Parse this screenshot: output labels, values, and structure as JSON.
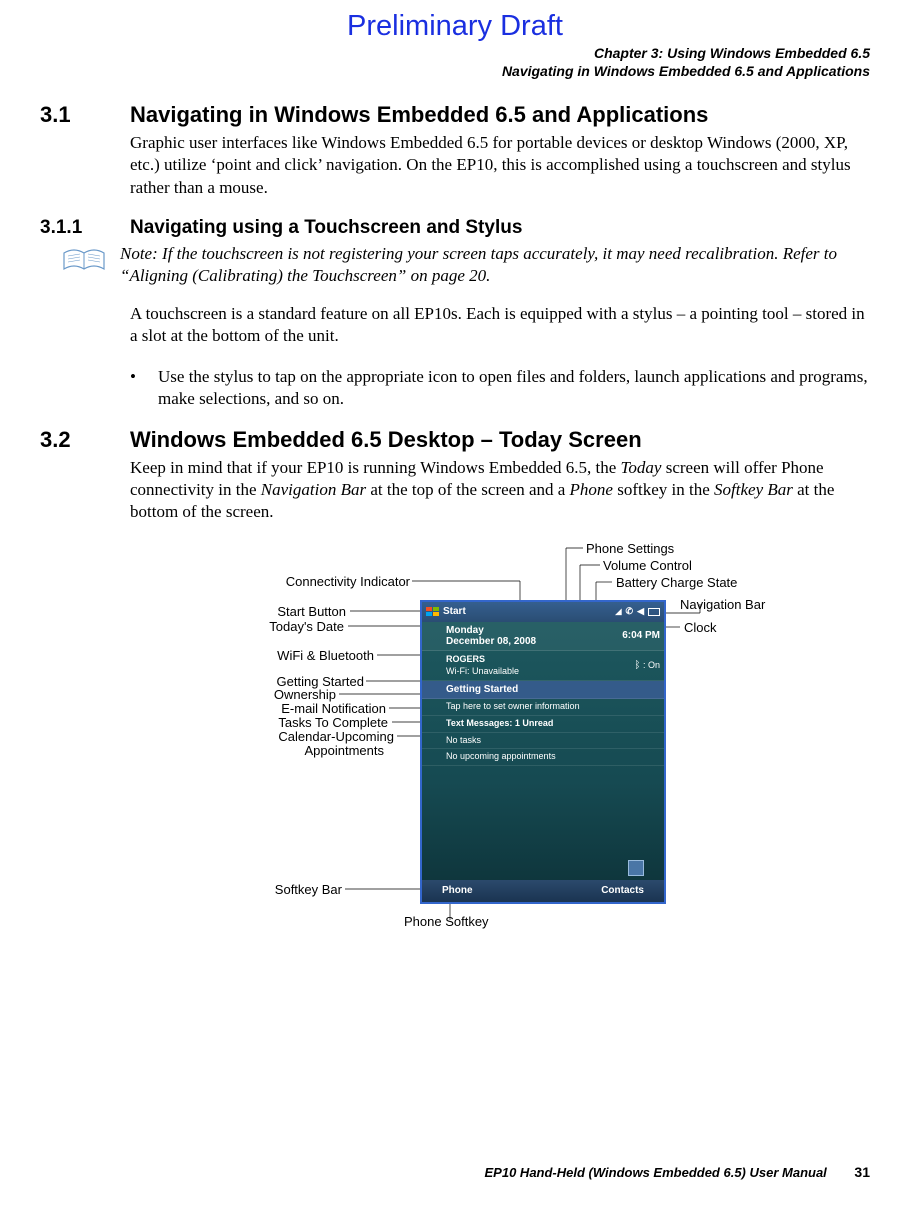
{
  "preliminary": "Preliminary Draft",
  "chapter_line1": "Chapter 3:  Using Windows Embedded 6.5",
  "chapter_line2": "Navigating in Windows Embedded 6.5 and Applications",
  "s31_num": "3.1",
  "s31_title": "Navigating in Windows Embedded 6.5 and Applications",
  "s31_body": "Graphic user interfaces like Windows Embedded 6.5 for portable devices or desktop Windows (2000, XP, etc.) utilize ‘point and click’ navigation. On the EP10, this is accomplished using a touchscreen and stylus rather than a mouse.",
  "s311_num": "3.1.1",
  "s311_title": "Navigating using a Touchscreen and Stylus",
  "note_prefix": "Note: ",
  "note_text": "If the touchscreen is not registering your screen taps accurately, it may need recalibration. Refer to “Aligning (Calibrating) the Touchscreen” on page 20.",
  "s311_body": "A touchscreen is a standard feature on all EP10s. Each is equipped with a stylus – a pointing tool – stored in a slot at the bottom of the unit.",
  "bullet1": "Use the stylus to tap on the appropriate icon to open files and folders, launch applications and programs, make selections, and so on.",
  "s32_num": "3.2",
  "s32_title": "Windows Embedded 6.5 Desktop – Today Screen",
  "s32_body_a": "Keep in mind that if your EP10 is running Windows Embedded 6.5, the ",
  "s32_today": "Today",
  "s32_body_b": " screen will offer Phone connectivity in the ",
  "s32_nav": "Navigation Bar",
  "s32_body_c": " at the top of the screen and a ",
  "s32_phone": "Phone",
  "s32_body_d": " softkey in the ",
  "s32_soft": "Softkey Bar",
  "s32_body_e": " at the bottom of the screen.",
  "device": {
    "start": "Start",
    "day": "Monday",
    "date": "December 08, 2008",
    "clock": "6:04 PM",
    "rogers": "ROGERS",
    "wifi": "Wi-Fi: Unavailable",
    "wifi_r": " : On",
    "getting": "Getting Started",
    "owner": "Tap here to set owner information",
    "messages": "Text Messages: 1 Unread",
    "tasks": "No tasks",
    "appts": "No upcoming appointments",
    "phone": "Phone",
    "contacts": "Contacts"
  },
  "labels": {
    "conn": "Connectivity Indicator",
    "start": "Start Button",
    "today": "Today's Date",
    "wifi": "WiFi & Bluetooth",
    "getting": "Getting Started",
    "owner": "Ownership",
    "email": "E-mail Notification",
    "tasks": "Tasks To Complete",
    "cal1": "Calendar-Upcoming",
    "cal2": "Appointments",
    "softkey": "Softkey Bar",
    "phonesoft": "Phone Softkey",
    "phoneset": "Phone Settings",
    "volume": "Volume Control",
    "battery": "Battery Charge State",
    "navbar": "Navigation Bar",
    "clock": "Clock"
  },
  "footer_text": "EP10 Hand-Held (Windows Embedded 6.5) User Manual",
  "page_number": "31"
}
